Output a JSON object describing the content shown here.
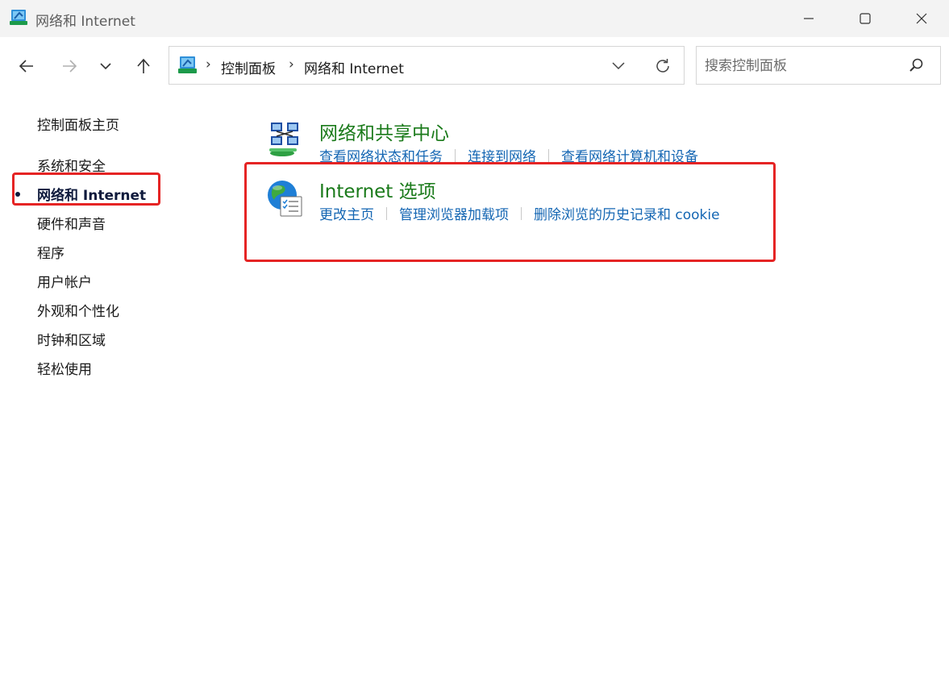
{
  "window": {
    "title": "网络和 Internet",
    "icon": "control-panel-icon",
    "controls": [
      "minimize-icon",
      "maximize-icon",
      "close-icon"
    ]
  },
  "navigation": {
    "buttons": [
      "back-arrow-icon",
      "forward-arrow-icon",
      "chevron-down-icon",
      "up-arrow-icon"
    ]
  },
  "address_bar": {
    "breadcrumb": [
      "控制面板",
      "网络和 Internet"
    ]
  },
  "search": {
    "placeholder": "搜索控制面板"
  },
  "sidebar": {
    "home": "控制面板主页",
    "items": [
      {
        "label": "系统和安全",
        "active": false
      },
      {
        "label": "网络和 Internet",
        "active": true
      },
      {
        "label": "硬件和声音",
        "active": false
      },
      {
        "label": "程序",
        "active": false
      },
      {
        "label": "用户帐户",
        "active": false
      },
      {
        "label": "外观和个性化",
        "active": false
      },
      {
        "label": "时钟和区域",
        "active": false
      },
      {
        "label": "轻松使用",
        "active": false
      }
    ]
  },
  "categories": [
    {
      "title": "网络和共享中心",
      "icon": "network-sharing-icon",
      "links": [
        "查看网络状态和任务",
        "连接到网络",
        "查看网络计算机和设备"
      ]
    },
    {
      "title": "Internet 选项",
      "icon": "internet-options-globe-icon",
      "links": [
        "更改主页",
        "管理浏览器加载项",
        "删除浏览的历史记录和 cookie"
      ]
    }
  ],
  "colors": {
    "category_title": "#1a7a1a",
    "link": "#1466b3",
    "highlight": "#e52424",
    "titlebar": "#f3f3f3"
  }
}
